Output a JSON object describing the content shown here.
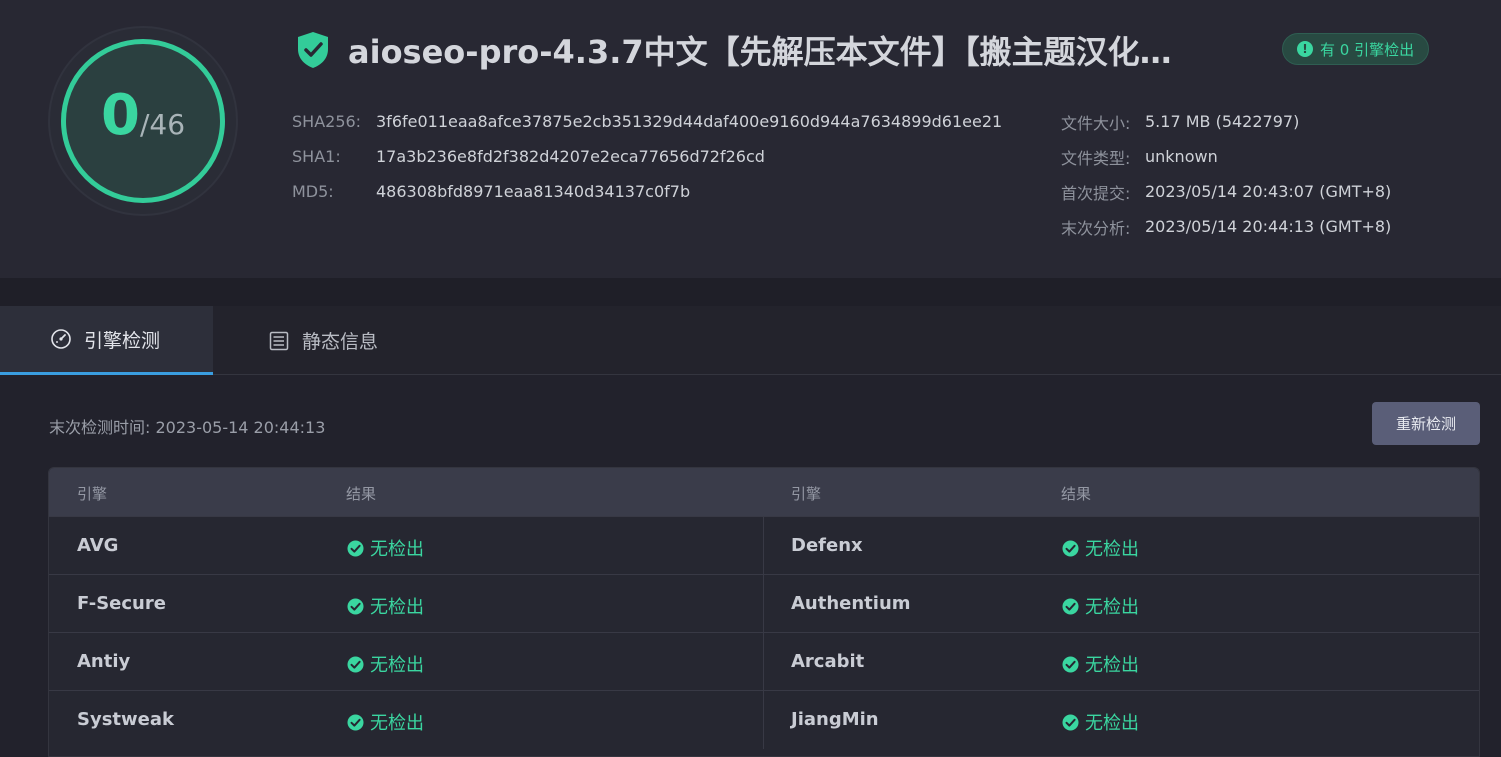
{
  "header": {
    "title": "aioseo-pro-4.3.7中文【先解压本文件】【搬主题汉化…",
    "badge": "有 0 引擎检出",
    "score": {
      "detected": "0",
      "total": "/46",
      "fraction": 0
    },
    "hashes": [
      {
        "label": "SHA256:",
        "value": "3f6fe011eaa8afce37875e2cb351329d44daf400e9160d944a7634899d61ee21"
      },
      {
        "label": "SHA1:",
        "value": "17a3b236e8fd2f382d4207e2eca77656d72f26cd"
      },
      {
        "label": "MD5:",
        "value": "486308bfd8971eaa81340d34137c0f7b"
      }
    ],
    "meta": [
      {
        "label": "文件大小:",
        "value": "5.17 MB (5422797)"
      },
      {
        "label": "文件类型:",
        "value": "unknown"
      },
      {
        "label": "首次提交:",
        "value": "2023/05/14 20:43:07 (GMT+8)"
      },
      {
        "label": "末次分析:",
        "value": "2023/05/14 20:44:13 (GMT+8)"
      }
    ]
  },
  "tabs": {
    "engine": "引擎检测",
    "static": "静态信息"
  },
  "scan": {
    "last_check": "末次检测时间: 2023-05-14 20:44:13",
    "recheck_label": "重新检测"
  },
  "table": {
    "headers": {
      "engine_left": "引擎",
      "result_left": "结果",
      "engine_right": "引擎",
      "result_right": "结果"
    },
    "rows": [
      {
        "left": {
          "engine": "AVG",
          "result": "无检出"
        },
        "right": {
          "engine": "Defenx",
          "result": "无检出"
        }
      },
      {
        "left": {
          "engine": "F-Secure",
          "result": "无检出"
        },
        "right": {
          "engine": "Authentium",
          "result": "无检出"
        }
      },
      {
        "left": {
          "engine": "Antiy",
          "result": "无检出"
        },
        "right": {
          "engine": "Arcabit",
          "result": "无检出"
        }
      },
      {
        "left": {
          "engine": "Systweak",
          "result": "无检出"
        },
        "right": {
          "engine": "JiangMin",
          "result": "无检出"
        }
      }
    ]
  },
  "colors": {
    "accent": "#3ad6a0",
    "tab_underline": "#3a9ee0"
  }
}
